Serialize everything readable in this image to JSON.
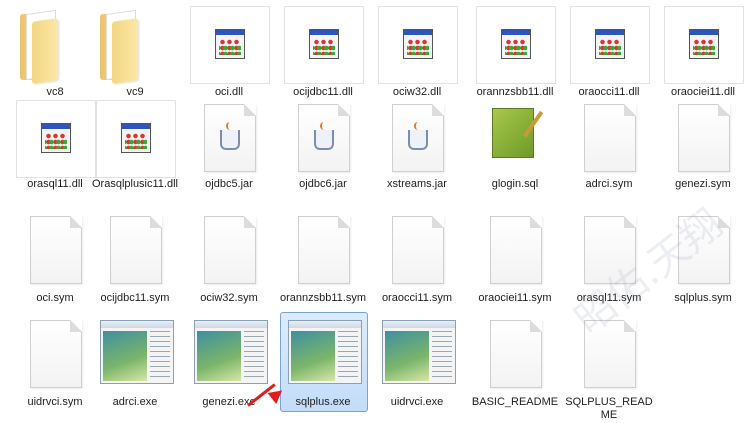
{
  "files": [
    {
      "label": "vc8",
      "type": "folder"
    },
    {
      "label": "vc9",
      "type": "folder"
    },
    {
      "label": "oci.dll",
      "type": "dll"
    },
    {
      "label": "ocijdbc11.dll",
      "type": "dll"
    },
    {
      "label": "ociw32.dll",
      "type": "dll"
    },
    {
      "label": "orannzsbb11.dll",
      "type": "dll"
    },
    {
      "label": "oraocci11.dll",
      "type": "dll"
    },
    {
      "label": "oraociei11.dll",
      "type": "dll"
    },
    {
      "label": "orasql11.dll",
      "type": "dll"
    },
    {
      "label": "Orasqlplusic11.dll",
      "type": "dll"
    },
    {
      "label": "ojdbc5.jar",
      "type": "jar"
    },
    {
      "label": "ojdbc6.jar",
      "type": "jar"
    },
    {
      "label": "xstreams.jar",
      "type": "jar"
    },
    {
      "label": "glogin.sql",
      "type": "sql"
    },
    {
      "label": "adrci.sym",
      "type": "page"
    },
    {
      "label": "genezi.sym",
      "type": "page"
    },
    {
      "label": "oci.sym",
      "type": "page"
    },
    {
      "label": "ocijdbc11.sym",
      "type": "page"
    },
    {
      "label": "ociw32.sym",
      "type": "page"
    },
    {
      "label": "orannzsbb11.sym",
      "type": "page"
    },
    {
      "label": "oraocci11.sym",
      "type": "page"
    },
    {
      "label": "oraociei11.sym",
      "type": "page"
    },
    {
      "label": "orasql11.sym",
      "type": "page"
    },
    {
      "label": "sqlplus.sym",
      "type": "page"
    },
    {
      "label": "uidrvci.sym",
      "type": "page"
    },
    {
      "label": "adrci.exe",
      "type": "exe"
    },
    {
      "label": "genezi.exe",
      "type": "exe"
    },
    {
      "label": "sqlplus.exe",
      "type": "exe",
      "selected": true
    },
    {
      "label": "uidrvci.exe",
      "type": "exe"
    },
    {
      "label": "BASIC_README",
      "type": "page"
    },
    {
      "label": "SQLPLUS_README",
      "type": "page"
    }
  ],
  "watermark": "昭佑.天翔"
}
